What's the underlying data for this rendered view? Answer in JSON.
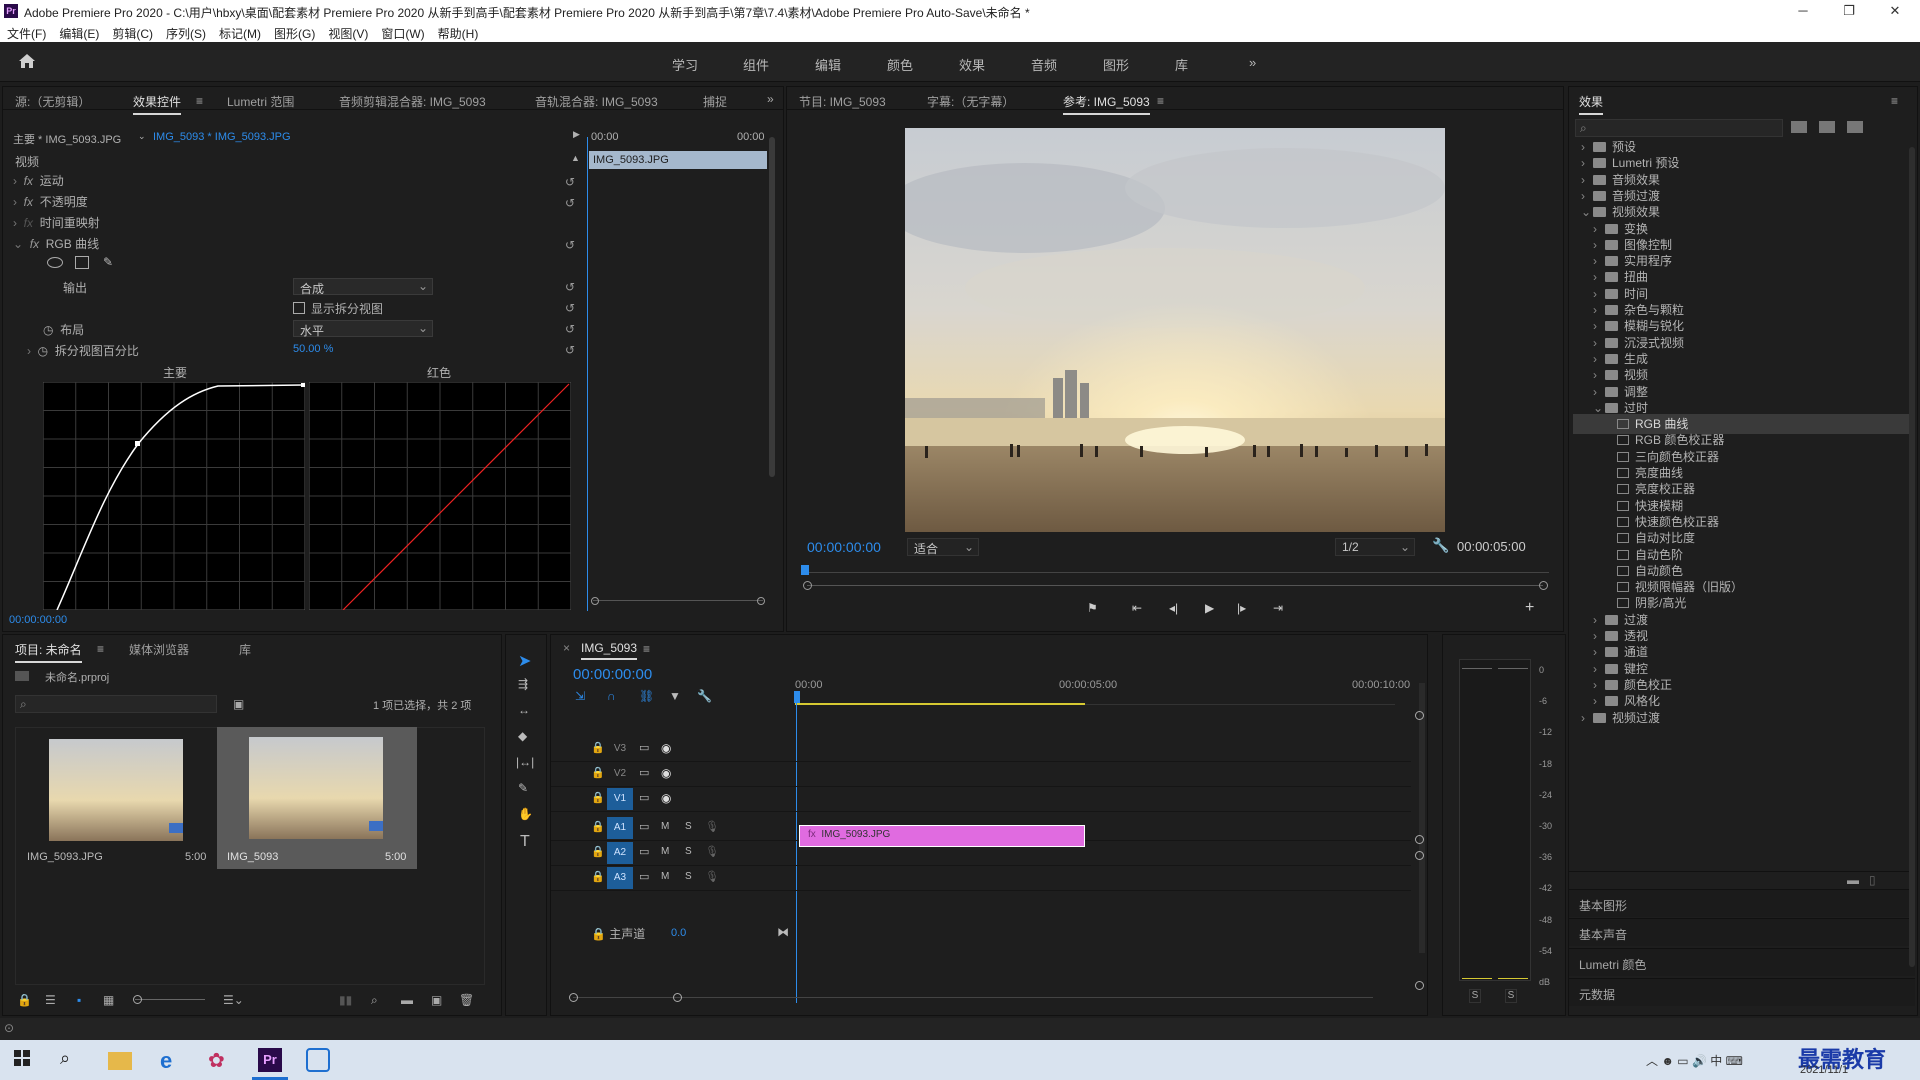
{
  "window": {
    "title": "Adobe Premiere Pro 2020 - C:\\用户\\hbxy\\桌面\\配套素材 Premiere Pro 2020 从新手到高手\\配套素材 Premiere Pro 2020 从新手到高手\\第7章\\7.4\\素材\\Adobe Premiere Pro Auto-Save\\未命名 *",
    "logo": "Pr"
  },
  "menu": [
    "文件(F)",
    "编辑(E)",
    "剪辑(C)",
    "序列(S)",
    "标记(M)",
    "图形(G)",
    "视图(V)",
    "窗口(W)",
    "帮助(H)"
  ],
  "workspaces": [
    "学习",
    "组件",
    "编辑",
    "颜色",
    "效果",
    "音频",
    "图形",
    "库"
  ],
  "source_panel": {
    "tabs": [
      "源:（无剪辑）",
      "效果控件",
      "Lumetri 范围",
      "音频剪辑混合器: IMG_5093",
      "音轨混合器: IMG_5093",
      "捕捉"
    ],
    "master": "主要 * IMG_5093.JPG",
    "clip": "IMG_5093 * IMG_5093.JPG",
    "t0": "00:00",
    "t1": "00:00",
    "clip_bar": "IMG_5093.JPG",
    "section": "视频",
    "effects": [
      "运动",
      "不透明度",
      "时间重映射",
      "RGB 曲线"
    ],
    "output_label": "输出",
    "output_value": "合成",
    "split_label": "显示拆分视图",
    "layout_label": "布局",
    "layout_value": "水平",
    "pct_label": "拆分视图百分比",
    "pct_value": "50.00 %",
    "curve_master": "主要",
    "curve_red": "红色",
    "timecode": "00:00:00:00"
  },
  "program_panel": {
    "tabs": [
      "节目: IMG_5093",
      "字幕:（无字幕）",
      "参考: IMG_5093"
    ],
    "timecode": "00:00:00:00",
    "fit": "适合",
    "res": "1/2",
    "duration": "00:00:05:00"
  },
  "effects_panel": {
    "title": "效果",
    "tree": [
      {
        "label": "预设",
        "level": 0
      },
      {
        "label": "Lumetri 预设",
        "level": 0
      },
      {
        "label": "音频效果",
        "level": 0
      },
      {
        "label": "音频过渡",
        "level": 0
      },
      {
        "label": "视频效果",
        "level": 0,
        "open": true
      },
      {
        "label": "变换",
        "level": 1
      },
      {
        "label": "图像控制",
        "level": 1
      },
      {
        "label": "实用程序",
        "level": 1
      },
      {
        "label": "扭曲",
        "level": 1
      },
      {
        "label": "时间",
        "level": 1
      },
      {
        "label": "杂色与颗粒",
        "level": 1
      },
      {
        "label": "模糊与锐化",
        "level": 1
      },
      {
        "label": "沉浸式视频",
        "level": 1
      },
      {
        "label": "生成",
        "level": 1
      },
      {
        "label": "视频",
        "level": 1
      },
      {
        "label": "调整",
        "level": 1
      },
      {
        "label": "过时",
        "level": 1,
        "open": true
      },
      {
        "label": "RGB 曲线",
        "level": 2,
        "selected": true
      },
      {
        "label": "RGB 颜色校正器",
        "level": 2
      },
      {
        "label": "三向颜色校正器",
        "level": 2
      },
      {
        "label": "亮度曲线",
        "level": 2
      },
      {
        "label": "亮度校正器",
        "level": 2
      },
      {
        "label": "快速模糊",
        "level": 2
      },
      {
        "label": "快速颜色校正器",
        "level": 2
      },
      {
        "label": "自动对比度",
        "level": 2
      },
      {
        "label": "自动色阶",
        "level": 2
      },
      {
        "label": "自动颜色",
        "level": 2
      },
      {
        "label": "视频限幅器（旧版）",
        "level": 2
      },
      {
        "label": "阴影/高光",
        "level": 2
      },
      {
        "label": "过渡",
        "level": 1
      },
      {
        "label": "透视",
        "level": 1
      },
      {
        "label": "通道",
        "level": 1
      },
      {
        "label": "键控",
        "level": 1
      },
      {
        "label": "颜色校正",
        "level": 1
      },
      {
        "label": "风格化",
        "level": 1
      },
      {
        "label": "视频过渡",
        "level": 0
      }
    ],
    "bottom": [
      "基本图形",
      "基本声音",
      "Lumetri 颜色",
      "元数据"
    ]
  },
  "project_panel": {
    "tabs": [
      "项目: 未命名",
      "媒体浏览器",
      "库"
    ],
    "file": "未命名.prproj",
    "selection": "1 项已选择，共 2 项",
    "items": [
      {
        "name": "IMG_5093.JPG",
        "dur": "5:00"
      },
      {
        "name": "IMG_5093",
        "dur": "5:00"
      }
    ]
  },
  "timeline": {
    "tab": "IMG_5093",
    "timecode": "00:00:00:00",
    "ruler": [
      "00:00",
      "00:00:05:00",
      "00:00:10:00"
    ],
    "tracks": [
      "V3",
      "V2",
      "V1",
      "A1",
      "A2",
      "A3"
    ],
    "master_label": "主声道",
    "master_val": "0.0",
    "clip": "IMG_5093.JPG"
  },
  "meter": {
    "scale": [
      "0",
      "-6",
      "-12",
      "-18",
      "-24",
      "-30",
      "-36",
      "-42",
      "-48",
      "-54",
      "dB"
    ],
    "solo": [
      "S",
      "S"
    ]
  },
  "taskbar": {
    "time": "2021/11/1",
    "watermark": "最需教育"
  }
}
